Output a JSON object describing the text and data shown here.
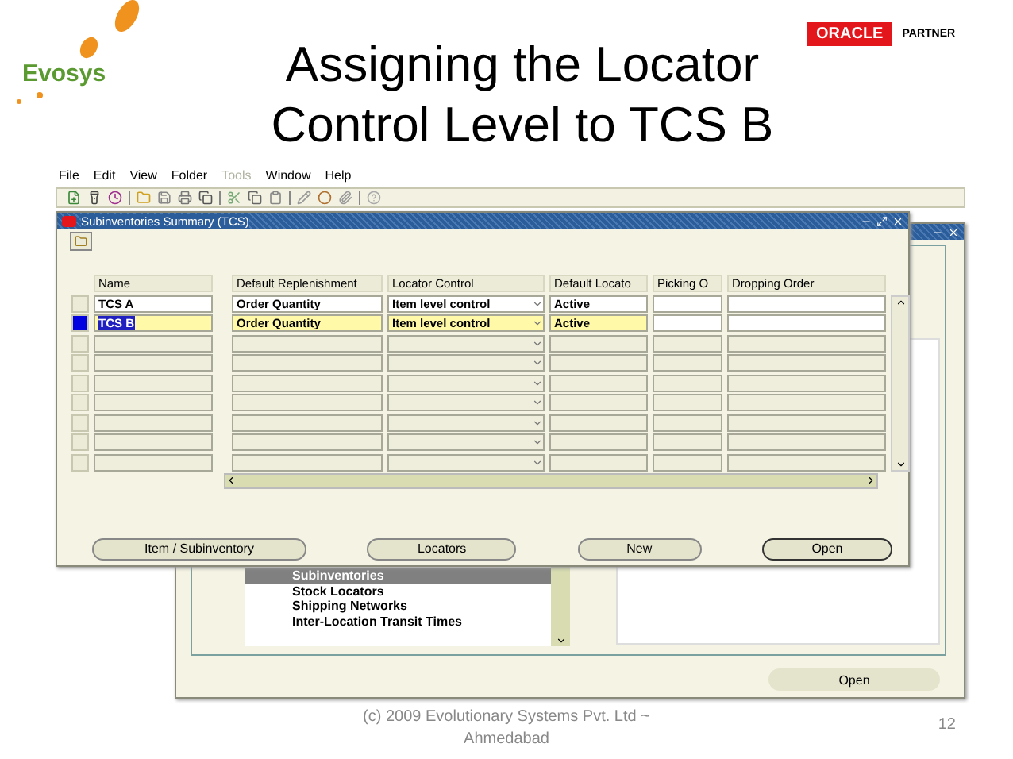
{
  "logo": {
    "name": "Evosys"
  },
  "title_lines": [
    "Assigning the Locator",
    "Control Level to TCS B"
  ],
  "partner_badge": {
    "brand": "ORACLE",
    "label": "PARTNER"
  },
  "menu": [
    {
      "label": "File",
      "disabled": false
    },
    {
      "label": "Edit",
      "disabled": false
    },
    {
      "label": "View",
      "disabled": false
    },
    {
      "label": "Folder",
      "disabled": false
    },
    {
      "label": "Tools",
      "disabled": true
    },
    {
      "label": "Window",
      "disabled": false
    },
    {
      "label": "Help",
      "disabled": false
    }
  ],
  "front_window": {
    "title": "Subinventories Summary (TCS)",
    "columns": [
      "Name",
      "Default Replenishment",
      "Locator Control",
      "Default Locato",
      "Picking O",
      "Dropping Order"
    ],
    "rows": [
      {
        "name": "TCS A",
        "replenishment": "Order Quantity",
        "locator_control": "Item level control",
        "default_locator_status": "Active",
        "selected": false
      },
      {
        "name": "TCS B",
        "replenishment": "Order Quantity",
        "locator_control": "Item level control",
        "default_locator_status": "Active",
        "selected": true
      },
      {
        "selected": false
      },
      {
        "selected": false
      },
      {
        "selected": false
      },
      {
        "selected": false
      },
      {
        "selected": false
      },
      {
        "selected": false
      },
      {
        "selected": false
      }
    ],
    "buttons": [
      {
        "label": "Item / Subinventory",
        "default": false
      },
      {
        "label": "Locators",
        "default": false
      },
      {
        "label": "New",
        "default": false
      },
      {
        "label": "Open",
        "default": true
      }
    ]
  },
  "back_window": {
    "list_items": [
      {
        "label": "Subinventories",
        "selected": true
      },
      {
        "label": "Stock Locators",
        "selected": false
      },
      {
        "label": "Shipping Networks",
        "selected": false
      },
      {
        "label": "Inter-Location Transit Times",
        "selected": false
      }
    ],
    "button": "Open"
  },
  "footer": {
    "copyright": "(c) 2009 Evolutionary Systems Pvt. Ltd ~ Ahmedabad",
    "page": "12"
  }
}
